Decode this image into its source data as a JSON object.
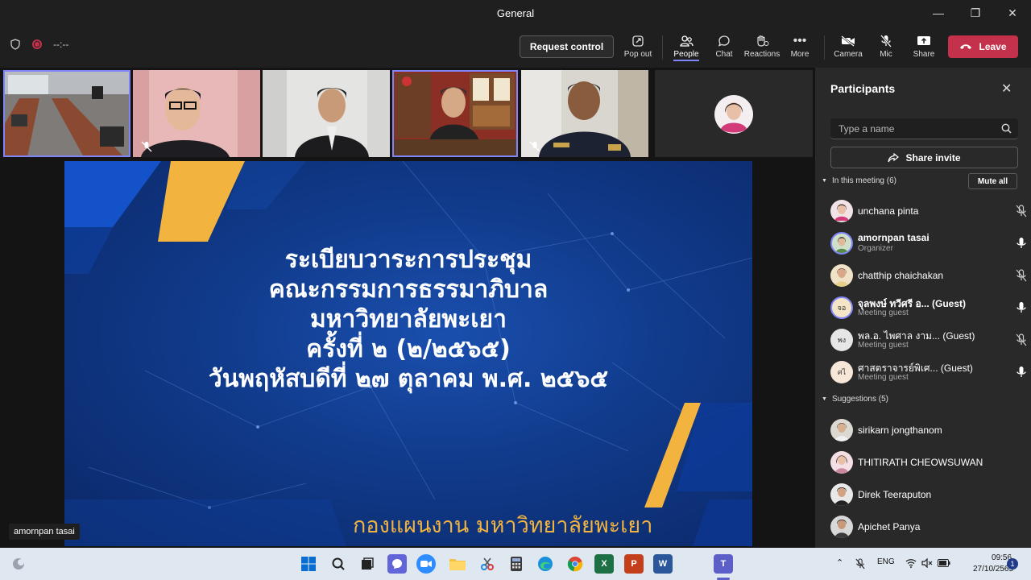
{
  "window": {
    "title": "General",
    "minimize": "—",
    "maximize": "❐",
    "close": "✕"
  },
  "toolbar": {
    "timer": "--:--",
    "request_control": "Request control",
    "pop_out": "Pop out",
    "people": "People",
    "chat": "Chat",
    "reactions": "Reactions",
    "more": "More",
    "camera": "Camera",
    "mic": "Mic",
    "share": "Share",
    "leave": "Leave"
  },
  "slide": {
    "title_lines": [
      "ระเบียบวาระการประชุม",
      "คณะกรรมการธรรมาภิบาล",
      "มหาวิทยาลัยพะเยา",
      "ครั้งที่ ๒ (๒/๒๕๖๕)",
      "วันพฤหัสบดีที่ ๒๗ ตุลาคม พ.ศ. ๒๕๖๕"
    ],
    "footer": "กองแผนงาน มหาวิทยาลัยพะเยา",
    "colors": {
      "accent": "#f3b43f",
      "blue": "#103a8a"
    }
  },
  "presenter_name": "amornpan tasai",
  "panel": {
    "title": "Participants",
    "search_placeholder": "Type a name",
    "share_invite": "Share invite",
    "in_meeting_label": "In this meeting (6)",
    "mute_all": "Mute all",
    "participants": [
      {
        "name": "unchana pinta",
        "role": ""
      },
      {
        "name": "amornpan tasai",
        "role": "Organizer"
      },
      {
        "name": "chatthip chaichakan",
        "role": ""
      },
      {
        "name": "จุลพงษ์ ทวีศรี อ...",
        "guest": "(Guest)",
        "role": "Meeting guest",
        "initials": "จอ"
      },
      {
        "name": "พล.อ. ไพศาล งาม...",
        "guest": "(Guest)",
        "role": "Meeting guest",
        "initials": "พง"
      },
      {
        "name": "ศาสตราจารย์พิเศ...",
        "guest": "(Guest)",
        "role": "Meeting guest",
        "initials": "ศไ"
      }
    ],
    "suggestions_label": "Suggestions (5)",
    "suggestions": [
      {
        "name": "sirikarn jongthanom"
      },
      {
        "name": "THITIRATH CHEOWSUWAN"
      },
      {
        "name": "Direk Teeraputon"
      },
      {
        "name": "Apichet Panya"
      }
    ]
  },
  "taskbar": {
    "language": "ENG",
    "time": "09:56",
    "date": "27/10/2565",
    "notifications": "1"
  }
}
